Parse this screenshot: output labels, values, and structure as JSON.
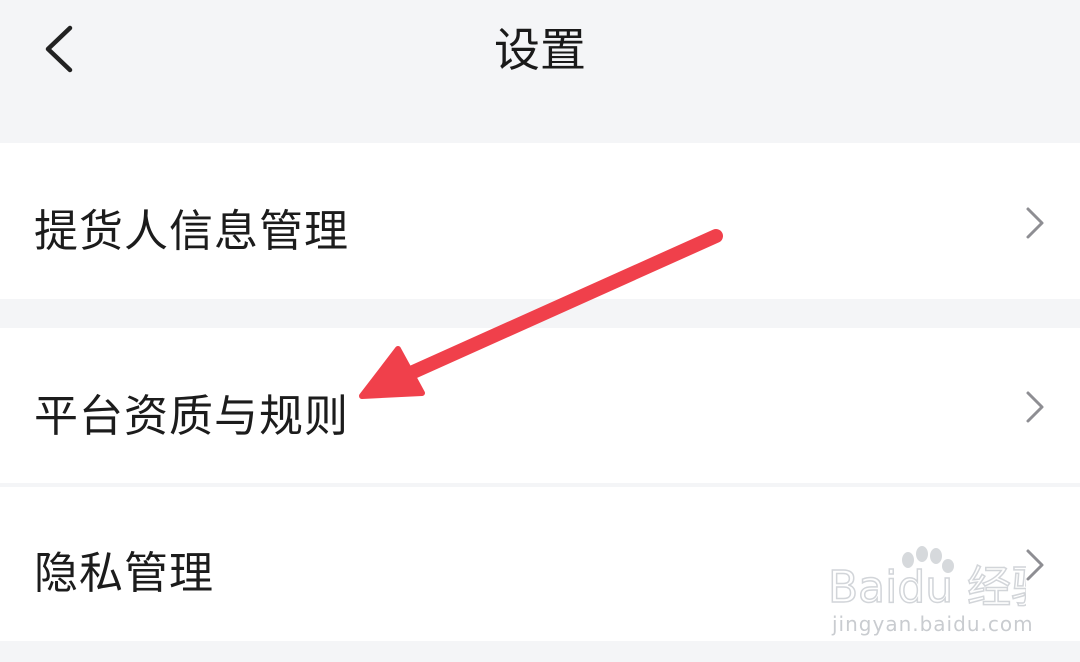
{
  "header": {
    "title": "设置",
    "back_icon": "chevron-left-icon"
  },
  "settings": {
    "items": [
      {
        "label": "提货人信息管理",
        "icon": "chevron-right-icon"
      },
      {
        "label": "平台资质与规则",
        "icon": "chevron-right-icon"
      },
      {
        "label": "隐私管理",
        "icon": "chevron-right-icon"
      }
    ]
  },
  "annotation": {
    "color": "#f0404b",
    "points_to": "平台资质与规则"
  },
  "watermark": {
    "brand": "Baidu 经验",
    "url": "jingyan.baidu.com"
  }
}
